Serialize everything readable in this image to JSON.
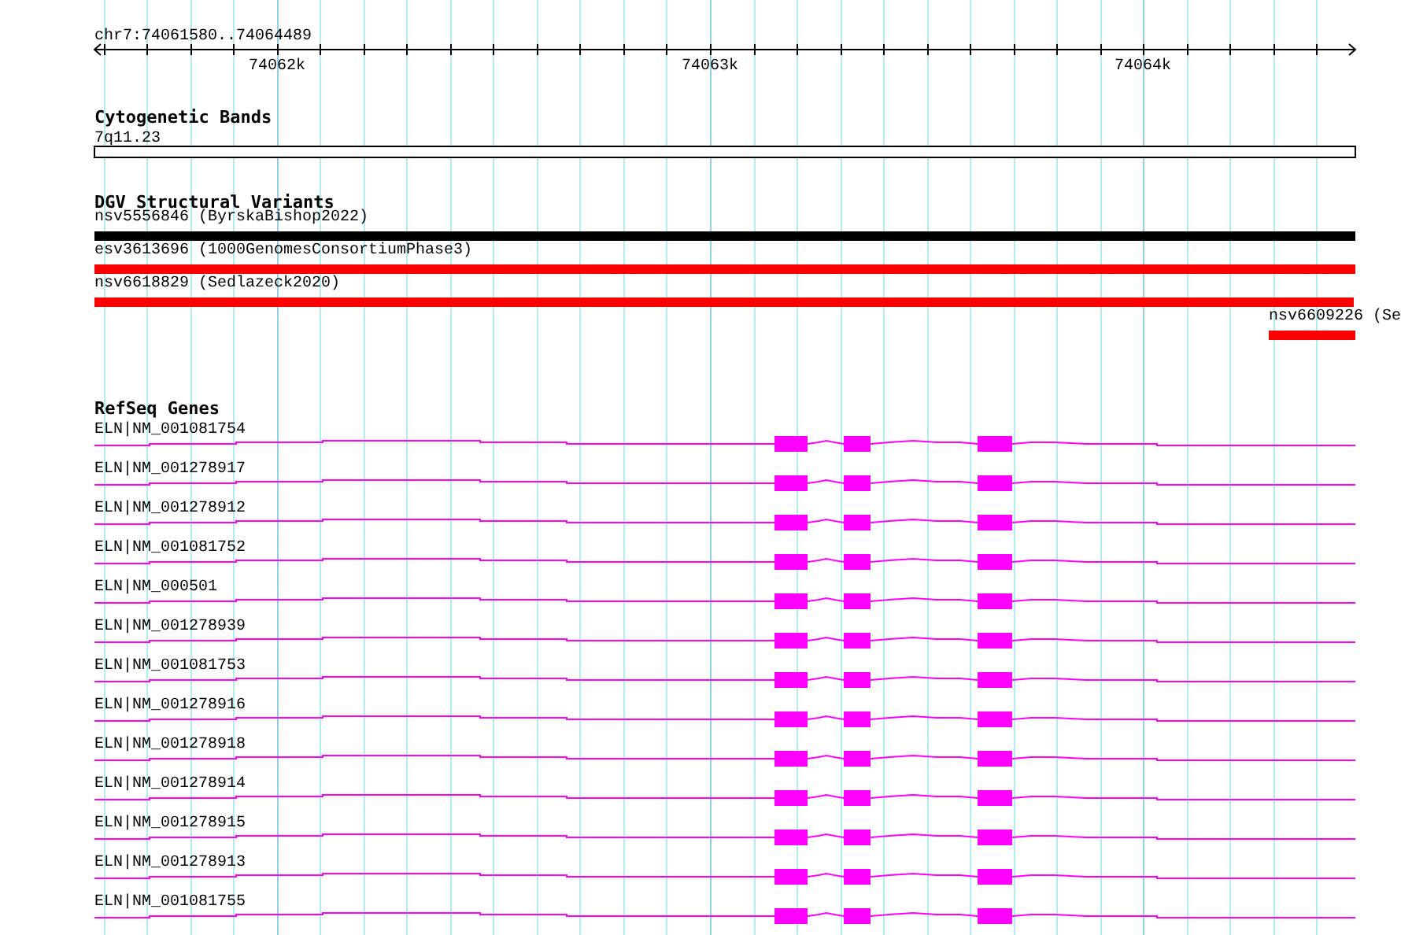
{
  "ruler": {
    "label": "chr7:74061580..74064489",
    "ticks": [
      "74062k",
      "74063k",
      "74064k"
    ]
  },
  "cytogenetic_bands": {
    "title": "Cytogenetic Bands",
    "band": "7q11.23"
  },
  "dgv_structural_variants": {
    "title": "DGV Structural Variants",
    "items": [
      {
        "label": "nsv5556846 (ByrskaBishop2022)",
        "color": "#000000"
      },
      {
        "label": "esv3613696 (1000GenomesConsortiumPhase3)",
        "color": "#ff0000"
      },
      {
        "label": "nsv6618829 (Sedlazeck2020)",
        "color": "#ff0000"
      },
      {
        "label": "nsv6609226 (Se",
        "color": "#ff0000"
      }
    ]
  },
  "refseq_genes": {
    "title": "RefSeq Genes",
    "transcripts": [
      "ELN|NM_001081754",
      "ELN|NM_001278917",
      "ELN|NM_001278912",
      "ELN|NM_001081752",
      "ELN|NM_000501",
      "ELN|NM_001278939",
      "ELN|NM_001081753",
      "ELN|NM_001278916",
      "ELN|NM_001278918",
      "ELN|NM_001278914",
      "ELN|NM_001278915",
      "ELN|NM_001278913",
      "ELN|NM_001081755"
    ]
  }
}
